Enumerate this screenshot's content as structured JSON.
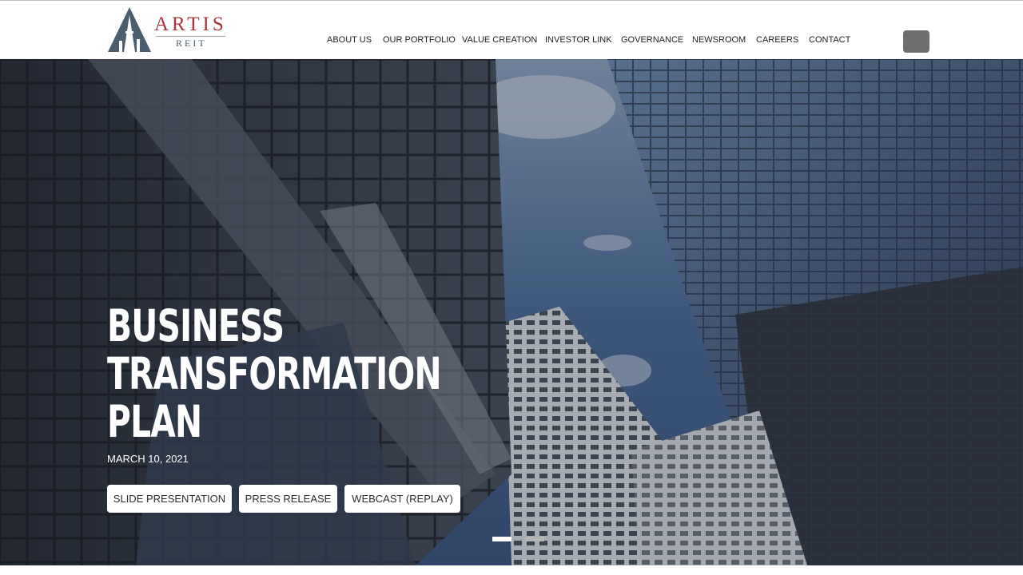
{
  "brand": {
    "name": "ARTIS",
    "sub": "REIT",
    "name_color": "#a8343a",
    "mark_color": "#4b5d6e"
  },
  "nav": {
    "items": [
      {
        "label": "ABOUT US"
      },
      {
        "label": "OUR PORTFOLIO"
      },
      {
        "label": "VALUE CREATION"
      },
      {
        "label": "INVESTOR LINK"
      },
      {
        "label": "GOVERNANCE"
      },
      {
        "label": "NEWSROOM"
      },
      {
        "label": "CAREERS"
      },
      {
        "label": "CONTACT"
      }
    ],
    "search_icon": "search-icon"
  },
  "hero": {
    "title_lines": [
      "BUSINESS",
      "TRANSFORMATION",
      "PLAN"
    ],
    "date": "MARCH 10, 2021",
    "buttons": [
      {
        "label": "SLIDE PRESENTATION"
      },
      {
        "label": "PRESS RELEASE"
      },
      {
        "label": "WEBCAST (REPLAY)"
      }
    ],
    "slides": {
      "count": 2,
      "active": 1
    }
  }
}
